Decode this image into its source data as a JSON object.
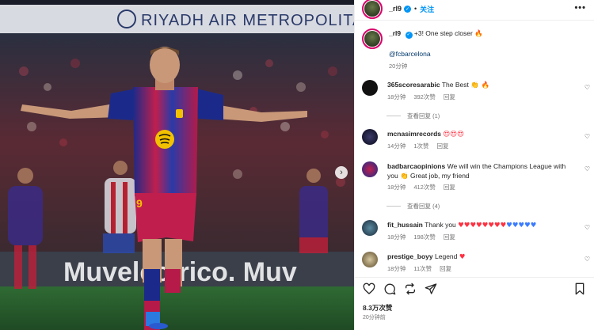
{
  "post": {
    "username": "_rl9",
    "follow_label": "关注",
    "more_label": "•••",
    "caption_text": "+3! One step closer",
    "caption_emoji": "🔥",
    "mention": "@fcbarcelona",
    "caption_time": "20分钟",
    "likes": "8.3万次赞",
    "posted_time": "20分钟前"
  },
  "comments": [
    {
      "username": "365scoresarabic",
      "text": "The Best",
      "emoji": "👏 🔥",
      "time": "18分钟",
      "likes": "392次赞",
      "reply": "回复",
      "view_replies": "查看回复 (1)"
    },
    {
      "username": "mcnasimrecords",
      "text": "",
      "emoji": "😍😍😍",
      "time": "14分钟",
      "likes": "1次赞",
      "reply": "回复",
      "view_replies": ""
    },
    {
      "username": "badbarcaopinions",
      "text": "We will win the Champions League with you 👏 Great job, my friend",
      "emoji": "",
      "time": "18分钟",
      "likes": "412次赞",
      "reply": "回复",
      "view_replies": "查看回复 (4)"
    },
    {
      "username": "fit_hussain",
      "text": "Thank you",
      "emoji": "♥♥♥♥♥♥♥♥",
      "emoji2": "♥♥♥♥♥",
      "time": "18分钟",
      "likes": "198次赞",
      "reply": "回复",
      "view_replies": ""
    },
    {
      "username": "prestige_boyy",
      "text": "Legend",
      "emoji": "♥",
      "time": "18分钟",
      "likes": "11次赞",
      "reply": "回复",
      "view_replies": ""
    }
  ],
  "media": {
    "banner_text": "RIYADH AIR METROPOLITANO",
    "board_text": "Muvelectrico. Muv",
    "shirt_number": "9"
  },
  "colors": {
    "accent_blue": "#0095f6",
    "mention": "#00376b",
    "muted": "#737373",
    "heart": "#ff3040"
  },
  "icons": {
    "like": "heart-icon",
    "comment": "comment-icon",
    "repost": "repost-icon",
    "share": "send-icon",
    "save": "bookmark-icon",
    "next": "chevron-right-icon"
  }
}
